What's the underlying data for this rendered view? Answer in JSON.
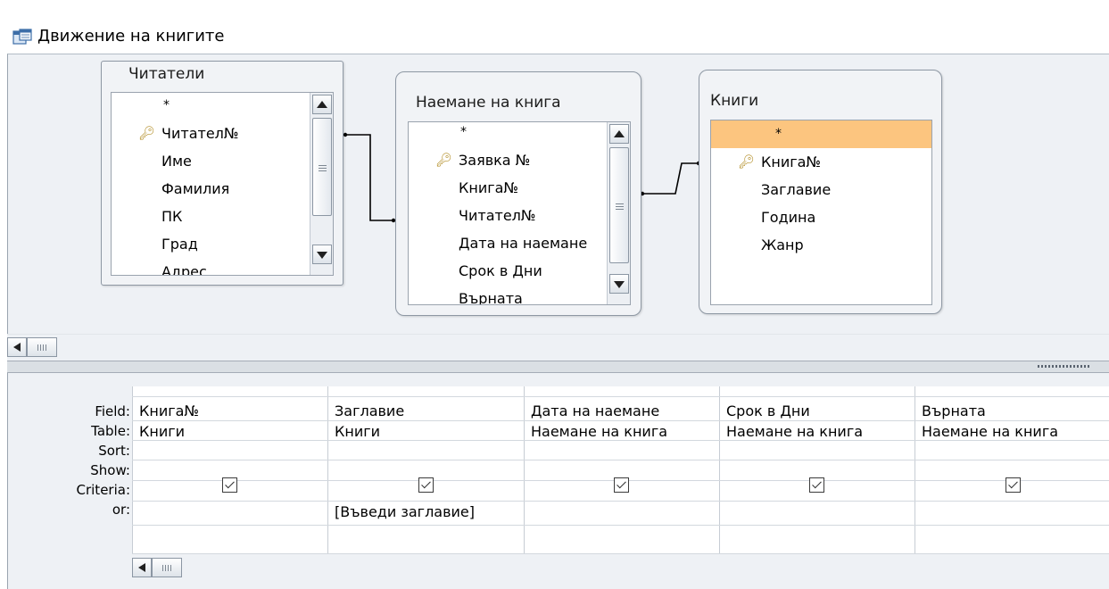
{
  "window": {
    "title": "Движение на книгите",
    "icon": "query-design-icon"
  },
  "tables": [
    {
      "title": "Читатели",
      "fields": [
        {
          "name": "*",
          "key": false
        },
        {
          "name": "Читател№",
          "key": true
        },
        {
          "name": "Име",
          "key": false
        },
        {
          "name": "Фамилия",
          "key": false
        },
        {
          "name": "ПК",
          "key": false
        },
        {
          "name": "Град",
          "key": false
        },
        {
          "name": "Адрес",
          "key": false
        }
      ]
    },
    {
      "title": "Наемане на книга",
      "fields": [
        {
          "name": "*",
          "key": false
        },
        {
          "name": "Заявка №",
          "key": true
        },
        {
          "name": "Книга№",
          "key": false
        },
        {
          "name": "Читател№",
          "key": false
        },
        {
          "name": "Дата на наемане",
          "key": false
        },
        {
          "name": "Срок в Дни",
          "key": false
        },
        {
          "name": "Върната",
          "key": false
        }
      ]
    },
    {
      "title": "Книги",
      "fields": [
        {
          "name": "*",
          "key": false,
          "selected": true
        },
        {
          "name": "Книга№",
          "key": true
        },
        {
          "name": "Заглавие",
          "key": false
        },
        {
          "name": "Година",
          "key": false
        },
        {
          "name": "Жанр",
          "key": false
        }
      ]
    }
  ],
  "grid": {
    "row_labels": [
      "Field:",
      "Table:",
      "Sort:",
      "Show:",
      "Criteria:",
      "or:"
    ],
    "columns": [
      {
        "field": "Книга№",
        "table": "Книги",
        "sort": "",
        "show": true,
        "criteria": "",
        "or": ""
      },
      {
        "field": "Заглавие",
        "table": "Книги",
        "sort": "",
        "show": true,
        "criteria": "[Въведи заглавие]",
        "or": ""
      },
      {
        "field": "Дата на наемане",
        "table": "Наемане на книга",
        "sort": "",
        "show": true,
        "criteria": "",
        "or": ""
      },
      {
        "field": "Срок в Дни",
        "table": "Наемане на книга",
        "sort": "",
        "show": true,
        "criteria": "",
        "or": ""
      },
      {
        "field": "Върната",
        "table": "Наемане на книга",
        "sort": "",
        "show": true,
        "criteria": "",
        "or": ""
      }
    ]
  },
  "colors": {
    "selected_row": "#fcc57f",
    "pane_bg": "#eef1f5"
  }
}
